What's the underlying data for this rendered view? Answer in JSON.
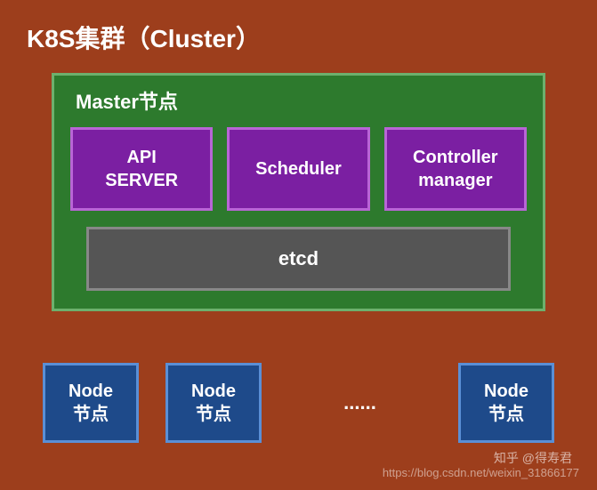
{
  "title": "K8S集群（Cluster）",
  "master": {
    "title": "Master节点",
    "components": {
      "api_server": "API\nSERVER",
      "scheduler": "Scheduler",
      "controller": "Controller\nmanager"
    },
    "etcd": "etcd"
  },
  "nodes": {
    "label_line1": "Node",
    "label_line2": "节点",
    "ellipsis": "......"
  },
  "watermark": {
    "zhihu": "知乎 @得寿君",
    "csdn": "https://blog.csdn.net/weixin_31866177"
  }
}
